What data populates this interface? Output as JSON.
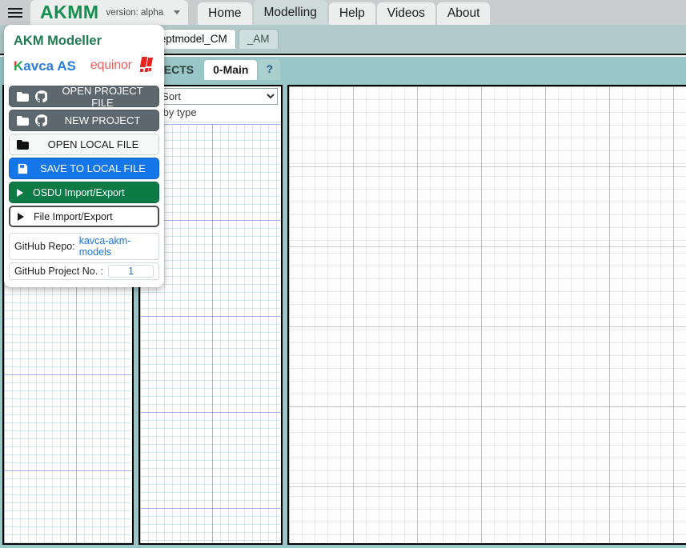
{
  "topnav": {
    "menu_icon": "hamburger-icon",
    "brand": "AKMM",
    "version": "version: alpha",
    "version_caret_icon": "chevron-down-icon",
    "tabs": [
      {
        "label": "Home",
        "active": false
      },
      {
        "label": "Modelling",
        "active": true
      },
      {
        "label": "Help",
        "active": false
      },
      {
        "label": "Videos",
        "active": false
      },
      {
        "label": "About",
        "active": false
      }
    ]
  },
  "doc_tabs": [
    {
      "label": "ceptmodel_CM",
      "active": true
    },
    {
      "label": "_AM",
      "active": false
    }
  ],
  "project_tabs": [
    {
      "label": "JECTS",
      "style": "muted"
    },
    {
      "label": "0-Main",
      "style": "active"
    },
    {
      "label": "?",
      "style": "help"
    }
  ],
  "panel_b": {
    "filter_select_value": "er/Sort",
    "filter_caret_icon": "chevron-down-icon",
    "sort_note": "ted by type"
  },
  "menu_panel": {
    "title": "AKM Modeller",
    "logos": {
      "kavca_initial": "K",
      "kavca_rest": "avca AS",
      "equinor_word": "equinor",
      "equinor_mark_icon": "equinor-star-icon"
    },
    "buttons": [
      {
        "label": "OPEN PROJECT FILE",
        "style": "dark",
        "icons": [
          "folder-icon",
          "github-icon"
        ]
      },
      {
        "label": "NEW PROJECT",
        "style": "dark",
        "icons": [
          "folder-icon",
          "github-icon"
        ]
      },
      {
        "label": "OPEN LOCAL FILE",
        "style": "light",
        "icons": [
          "folder-icon"
        ]
      },
      {
        "label": "SAVE TO LOCAL FILE",
        "style": "blue",
        "icons": [
          "save-icon"
        ]
      },
      {
        "label": "OSDU Import/Export",
        "style": "green",
        "icons": [
          "triangle-right-icon"
        ]
      },
      {
        "label": "File Import/Export",
        "style": "outline",
        "icons": [
          "triangle-right-icon"
        ]
      }
    ],
    "repo_label": "GitHub Repo:",
    "repo_link": "kavca-akm-models",
    "project_no_label": "GitHub Project No. :",
    "project_no_value": "1"
  },
  "colors": {
    "brand_green": "#13904f",
    "band_doc": "#b2c9c9",
    "band_proj": "#99c6c6",
    "nav_bg": "#c9cdcd",
    "accent_blue": "#1476e8",
    "accent_green": "#0c7a45",
    "link_blue": "#1a73e8"
  }
}
